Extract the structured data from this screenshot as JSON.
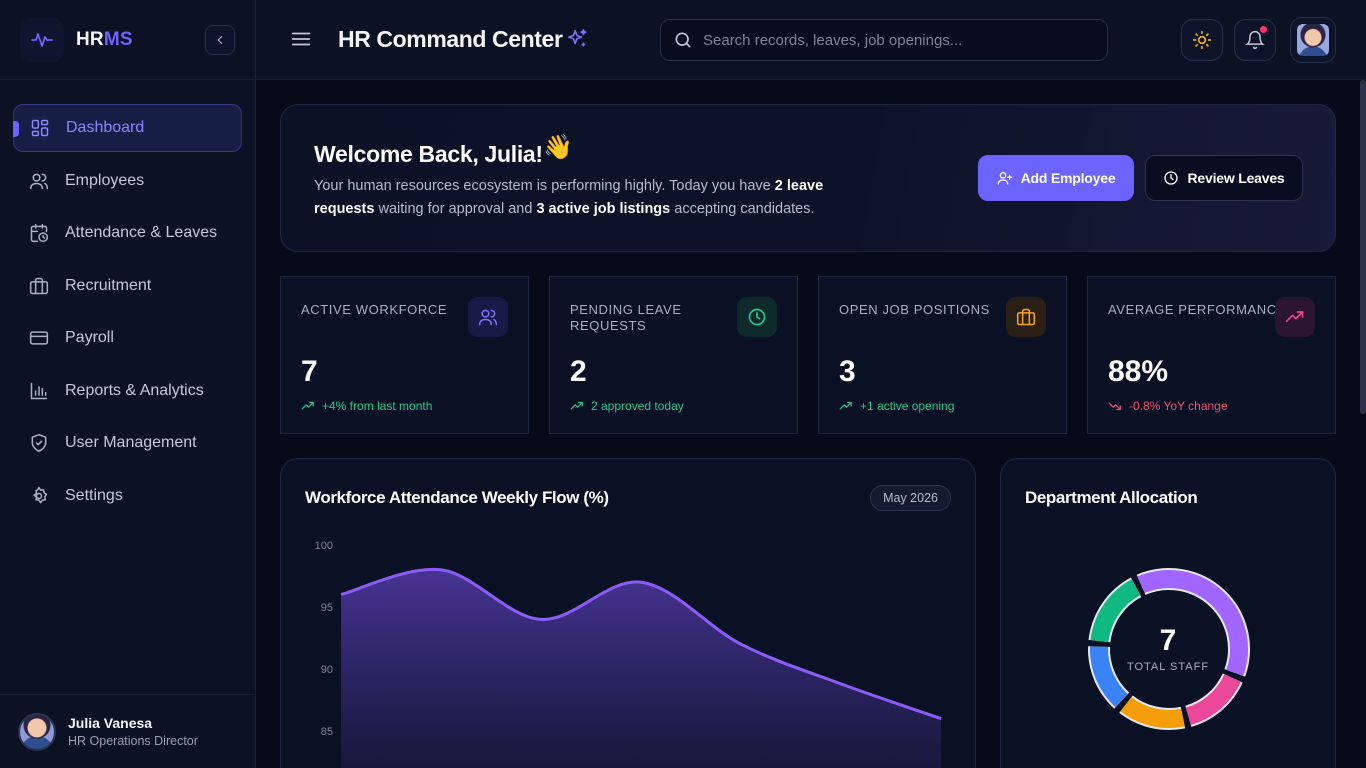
{
  "brand": {
    "name_hr": "HR",
    "name_ms": "MS"
  },
  "sidebar": {
    "items": [
      {
        "label": "Dashboard",
        "icon": "grid-icon",
        "active": true
      },
      {
        "label": "Employees",
        "icon": "users-icon"
      },
      {
        "label": "Attendance & Leaves",
        "icon": "calendar-clock-icon"
      },
      {
        "label": "Recruitment",
        "icon": "briefcase-icon"
      },
      {
        "label": "Payroll",
        "icon": "credit-card-icon"
      },
      {
        "label": "Reports & Analytics",
        "icon": "bar-chart-icon"
      },
      {
        "label": "User Management",
        "icon": "shield-check-icon"
      },
      {
        "label": "Settings",
        "icon": "gear-icon"
      }
    ],
    "user": {
      "name": "Julia Vanesa",
      "role": "HR Operations Director"
    }
  },
  "header": {
    "title": "HR Command Center",
    "search_placeholder": "Search records, leaves, job openings..."
  },
  "welcome": {
    "heading": "Welcome Back, Julia!",
    "emoji": "👋",
    "text_1": "Your human resources ecosystem is performing highly. Today you have ",
    "bold_1": "2 leave requests",
    "text_2": " waiting for approval and ",
    "bold_2": "3 active job listings",
    "text_3": " accepting candidates.",
    "add_label": "Add Employee",
    "review_label": "Review Leaves"
  },
  "stats": [
    {
      "label": "Active Workforce",
      "value": "7",
      "trend": "+4% from last month",
      "direction": "up",
      "icon": "users-icon",
      "color": "#6d63ff"
    },
    {
      "label": "Pending Leave Requests",
      "value": "2",
      "trend": "2 approved today",
      "direction": "up",
      "icon": "clock-icon",
      "color": "#22c98a"
    },
    {
      "label": "Open Job Positions",
      "value": "3",
      "trend": "+1 active opening",
      "direction": "up",
      "icon": "briefcase-icon",
      "color": "#f5a524"
    },
    {
      "label": "Average Performance",
      "value": "88%",
      "trend": "-0.8% YoY change",
      "direction": "down",
      "icon": "trending-up-icon",
      "color": "#f0468a"
    }
  ],
  "attendance": {
    "title": "Workforce Attendance Weekly Flow (%)",
    "period": "May 2026"
  },
  "department": {
    "title": "Department Allocation",
    "total": "7",
    "total_label": "TOTAL STAFF"
  },
  "chart_data": [
    {
      "type": "area",
      "title": "Workforce Attendance Weekly Flow (%)",
      "y_ticks": [
        100,
        95,
        90,
        85
      ],
      "ylim": [
        80,
        100
      ],
      "x": [
        1,
        2,
        3,
        4,
        5,
        6,
        7
      ],
      "values": [
        96,
        98,
        94,
        97,
        92,
        88.8,
        86
      ],
      "color": "#8b5cf6"
    },
    {
      "type": "pie",
      "title": "Department Allocation",
      "slices": [
        {
          "value": 2.3,
          "color": "#a066ff"
        },
        {
          "value": 0.9,
          "color": "#ec4899"
        },
        {
          "value": 0.9,
          "color": "#f59e0b"
        },
        {
          "value": 0.9,
          "color": "#3b82f6"
        },
        {
          "value": 1.0,
          "color": "#10b981"
        }
      ]
    }
  ]
}
